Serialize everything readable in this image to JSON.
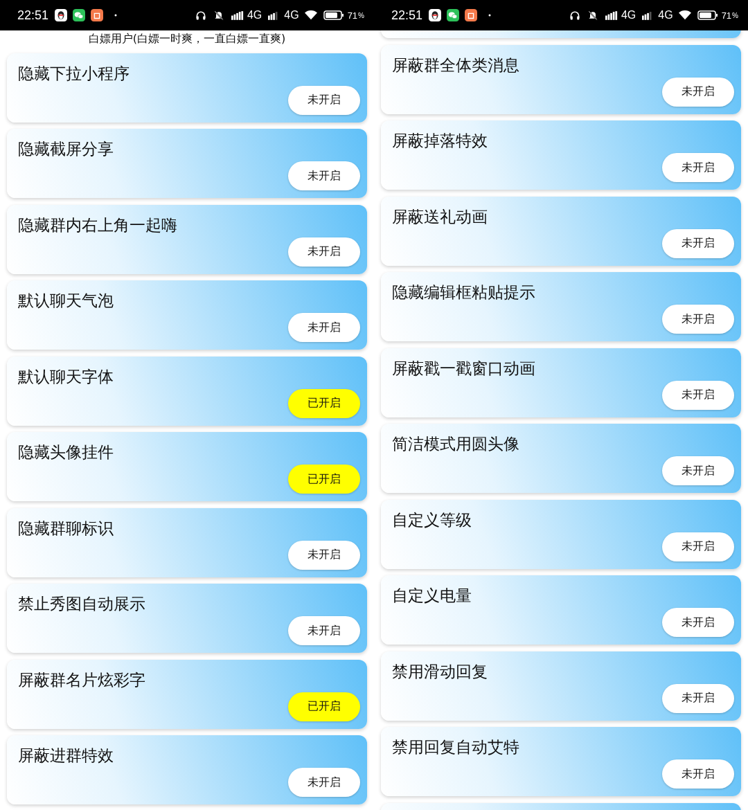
{
  "screens": [
    {
      "status_bar": {
        "time": "22:51",
        "network_1": "4G",
        "network_2": "4G",
        "battery_percent": "71",
        "battery_unit": "%"
      },
      "heading": "白嫖用户(白嫖一时爽，一直白嫖一直爽)",
      "settings": [
        {
          "title": "隐藏下拉小程序",
          "toggle": "未开启",
          "on": false
        },
        {
          "title": "隐藏截屏分享",
          "toggle": "未开启",
          "on": false
        },
        {
          "title": "隐藏群内右上角一起嗨",
          "toggle": "未开启",
          "on": false
        },
        {
          "title": "默认聊天气泡",
          "toggle": "未开启",
          "on": false
        },
        {
          "title": "默认聊天字体",
          "toggle": "已开启",
          "on": true
        },
        {
          "title": "隐藏头像挂件",
          "toggle": "已开启",
          "on": true
        },
        {
          "title": "隐藏群聊标识",
          "toggle": "未开启",
          "on": false
        },
        {
          "title": "禁止秀图自动展示",
          "toggle": "未开启",
          "on": false
        },
        {
          "title": "屏蔽群名片炫彩字",
          "toggle": "已开启",
          "on": true
        },
        {
          "title": "屏蔽进群特效",
          "toggle": "未开启",
          "on": false
        }
      ]
    },
    {
      "status_bar": {
        "time": "22:51",
        "network_1": "4G",
        "network_2": "4G",
        "battery_percent": "71",
        "battery_unit": "%"
      },
      "settings": [
        {
          "title": "屏蔽群全体类消息",
          "toggle": "未开启",
          "on": false
        },
        {
          "title": "屏蔽掉落特效",
          "toggle": "未开启",
          "on": false
        },
        {
          "title": "屏蔽送礼动画",
          "toggle": "未开启",
          "on": false
        },
        {
          "title": "隐藏编辑框粘贴提示",
          "toggle": "未开启",
          "on": false
        },
        {
          "title": "屏蔽戳一戳窗口动画",
          "toggle": "未开启",
          "on": false
        },
        {
          "title": "简洁模式用圆头像",
          "toggle": "未开启",
          "on": false
        },
        {
          "title": "自定义等级",
          "toggle": "未开启",
          "on": false
        },
        {
          "title": "自定义电量",
          "toggle": "未开启",
          "on": false
        },
        {
          "title": "禁用滑动回复",
          "toggle": "未开启",
          "on": false
        },
        {
          "title": "禁用回复自动艾特",
          "toggle": "未开启",
          "on": false
        }
      ]
    }
  ]
}
